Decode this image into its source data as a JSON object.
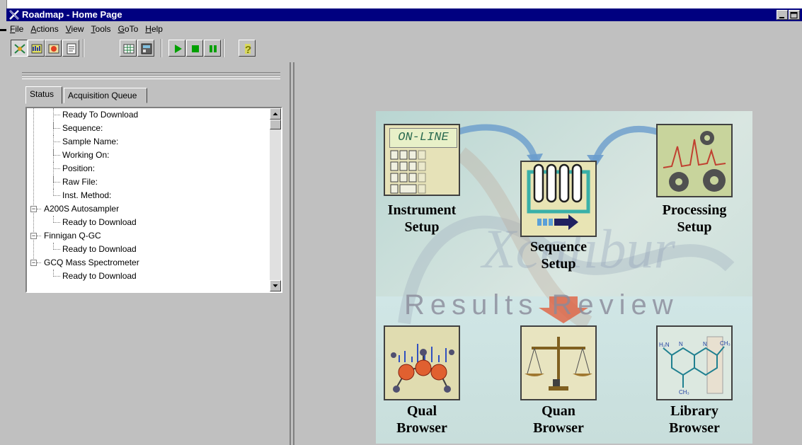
{
  "window": {
    "title": "Roadmap - Home Page"
  },
  "menu": [
    {
      "label": "File",
      "accel": "F",
      "rest": "ile"
    },
    {
      "label": "Actions",
      "accel": "A",
      "rest": "ctions"
    },
    {
      "label": "View",
      "accel": "V",
      "rest": "iew"
    },
    {
      "label": "Tools",
      "accel": "T",
      "rest": "ools"
    },
    {
      "label": "GoTo",
      "accel": "G",
      "rest": "oTo"
    },
    {
      "label": "Help",
      "accel": "H",
      "rest": "elp"
    }
  ],
  "toolbar": {
    "buttons": [
      {
        "icon": "roadmap-view-icon",
        "pressed": true
      },
      {
        "icon": "instrument-view-icon",
        "pressed": false
      },
      {
        "icon": "status-view-icon",
        "pressed": false
      },
      {
        "icon": "info-view-icon",
        "pressed": false
      },
      {
        "icon": "sequence-icon",
        "pressed": false
      },
      {
        "icon": "instrument-setup-icon",
        "pressed": false
      },
      {
        "icon": "start-icon",
        "pressed": false
      },
      {
        "icon": "stop-icon",
        "pressed": false
      },
      {
        "icon": "pause-icon",
        "pressed": false
      },
      {
        "icon": "help-icon",
        "pressed": false
      }
    ]
  },
  "status_panel": {
    "tabs": [
      {
        "label": "Status",
        "active": true
      },
      {
        "label": "Acquisition Queue",
        "active": false
      }
    ],
    "tree": [
      {
        "label": "Ready To Download",
        "level": 2,
        "expander": ""
      },
      {
        "label": "Sequence:",
        "level": 2,
        "expander": ""
      },
      {
        "label": "Sample Name:",
        "level": 2,
        "expander": ""
      },
      {
        "label": "Working On:",
        "level": 2,
        "expander": ""
      },
      {
        "label": "Position:",
        "level": 2,
        "expander": ""
      },
      {
        "label": "Raw File:",
        "level": 2,
        "expander": ""
      },
      {
        "label": "Inst. Method:",
        "level": 2,
        "expander": ""
      },
      {
        "label": "A200S Autosampler",
        "level": 1,
        "expander": "−"
      },
      {
        "label": "Ready to Download",
        "level": 2,
        "expander": ""
      },
      {
        "label": "Finnigan Q-GC",
        "level": 1,
        "expander": "−"
      },
      {
        "label": "Ready to Download",
        "level": 2,
        "expander": ""
      },
      {
        "label": "GCQ Mass Spectrometer",
        "level": 1,
        "expander": "−"
      },
      {
        "label": "Ready to Download",
        "level": 2,
        "expander": ""
      }
    ]
  },
  "roadmap": {
    "online_badge": "ON-LINE",
    "results_review": "Results Review",
    "watermark": "Xcalibur",
    "items": [
      {
        "id": "instrument-setup",
        "line1": "Instrument",
        "line2": "Setup"
      },
      {
        "id": "sequence-setup",
        "line1": "Sequence",
        "line2": "Setup"
      },
      {
        "id": "processing-setup",
        "line1": "Processing",
        "line2": "Setup"
      },
      {
        "id": "qual-browser",
        "line1": "Qual",
        "line2": "Browser"
      },
      {
        "id": "quan-browser",
        "line1": "Quan",
        "line2": "Browser"
      },
      {
        "id": "library-browser",
        "line1": "Library",
        "line2": "Browser"
      }
    ]
  }
}
